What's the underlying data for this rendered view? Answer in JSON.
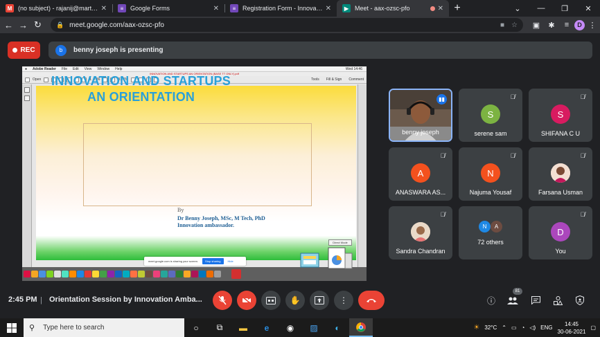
{
  "browser": {
    "tabs": [
      {
        "title": "(no subject) - rajanij@marthoma",
        "icon": "gmail-icon",
        "color": "#ea4335",
        "glyph": "M"
      },
      {
        "title": "Google Forms",
        "icon": "forms-icon",
        "color": "#7248b9",
        "glyph": "≡"
      },
      {
        "title": "Registration Form - Innovation A",
        "icon": "forms-icon",
        "color": "#7248b9",
        "glyph": "≡"
      },
      {
        "title": "Meet - aax-ozsc-pfo",
        "icon": "meet-icon",
        "color": "#00897b",
        "glyph": "▶",
        "active": true
      }
    ],
    "url": "meet.google.com/aax-ozsc-pfo",
    "profile_initial": "D"
  },
  "meet": {
    "rec_label": "REC",
    "presenter_initial": "b",
    "presenting_text": "benny joseph is presenting",
    "time": "2:45 PM",
    "separator": "|",
    "meeting_title": "Orientation Session by Innovation Amba...",
    "participant_count": "81",
    "participants": [
      {
        "name": "benny joseph",
        "type": "video",
        "speaking": true
      },
      {
        "name": "serene sam",
        "initial": "S",
        "color": "#7cb342"
      },
      {
        "name": "SHIFANA C U",
        "initial": "S",
        "color": "#d81b60"
      },
      {
        "name": "ANASWARA AS...",
        "initial": "A",
        "color": "#f4511e"
      },
      {
        "name": "Najuma Yousaf",
        "initial": "N",
        "color": "#f4511e"
      },
      {
        "name": "Farsana Usman",
        "type": "photo"
      },
      {
        "name": "Sandra Chandran",
        "type": "photo"
      },
      {
        "name": "72 others",
        "type": "others",
        "initials": [
          "N",
          "A"
        ],
        "colors": [
          "#1e88e5",
          "#6d4c41"
        ]
      },
      {
        "name": "You",
        "initial": "D",
        "color": "#ab47bc"
      }
    ]
  },
  "slide": {
    "app_menu": [
      "Adobe Reader",
      "File",
      "Edit",
      "View",
      "Window",
      "Help"
    ],
    "status_right": "Wed 14:46",
    "doc_title": "INNOVATION AND STARTUPS AN ORIENTATION (BASE TT ONLY).pdf",
    "open_label": "Open",
    "page": "1",
    "page_total": "/ 36",
    "zoom": "31.4%",
    "tools": [
      "Tools",
      "Fill & Sign",
      "Comment"
    ],
    "title_line1": "INNOVATION AND STARTUPS",
    "title_line2": "AN ORIENTATION",
    "by": "By",
    "author_line1": "Dr Benny Joseph, MSc, M Tech, PhD",
    "author_line2": "Innovation ambassador.",
    "sharing_notice": "meet.google.com is sharing your screen.",
    "stop_sharing": "Stop sharing",
    "hide": "Hide",
    "direct_mode": "Direct Mode"
  },
  "windows": {
    "search_placeholder": "Type here to search",
    "temperature": "32°C",
    "language": "ENG",
    "clock_time": "14:45",
    "clock_date": "30-06-2021"
  }
}
